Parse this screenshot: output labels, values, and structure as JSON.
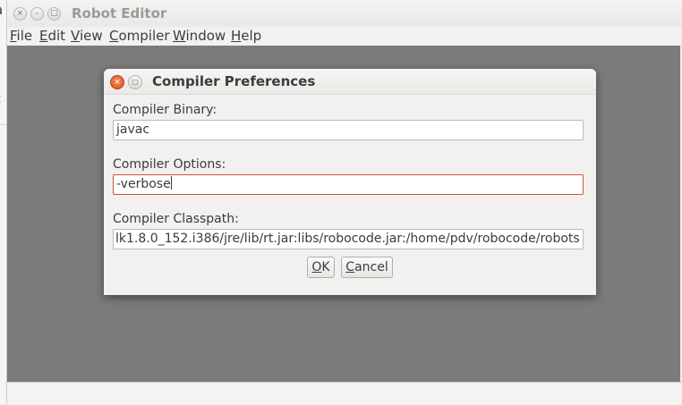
{
  "background_window": {
    "peek_text_top": "a",
    "peek_text_mid": "c"
  },
  "main_window": {
    "title": "Robot Editor",
    "close_glyph": "×",
    "minimize_glyph": "–",
    "maximize_glyph": "□",
    "menus": [
      {
        "mnemonic": "F",
        "rest": "ile"
      },
      {
        "mnemonic": "E",
        "rest": "dit"
      },
      {
        "mnemonic": "V",
        "rest": "iew"
      },
      {
        "mnemonic": "C",
        "rest": "ompiler"
      },
      {
        "mnemonic": "W",
        "rest": "indow"
      },
      {
        "mnemonic": "H",
        "rest": "elp"
      }
    ]
  },
  "dialog": {
    "title": "Compiler Preferences",
    "close_glyph": "×",
    "maximize_glyph": "□",
    "binary": {
      "label": "Compiler Binary:",
      "value": "javac"
    },
    "options": {
      "label": "Compiler Options:",
      "value": "-verbose"
    },
    "classpath": {
      "label": "Compiler Classpath:",
      "value": "lk1.8.0_152.i386/jre/lib/rt.jar:libs/robocode.jar:/home/pdv/robocode/robots"
    },
    "ok": {
      "mnemonic": "O",
      "rest": "K"
    },
    "cancel": {
      "mnemonic": "C",
      "rest": "ancel"
    }
  }
}
